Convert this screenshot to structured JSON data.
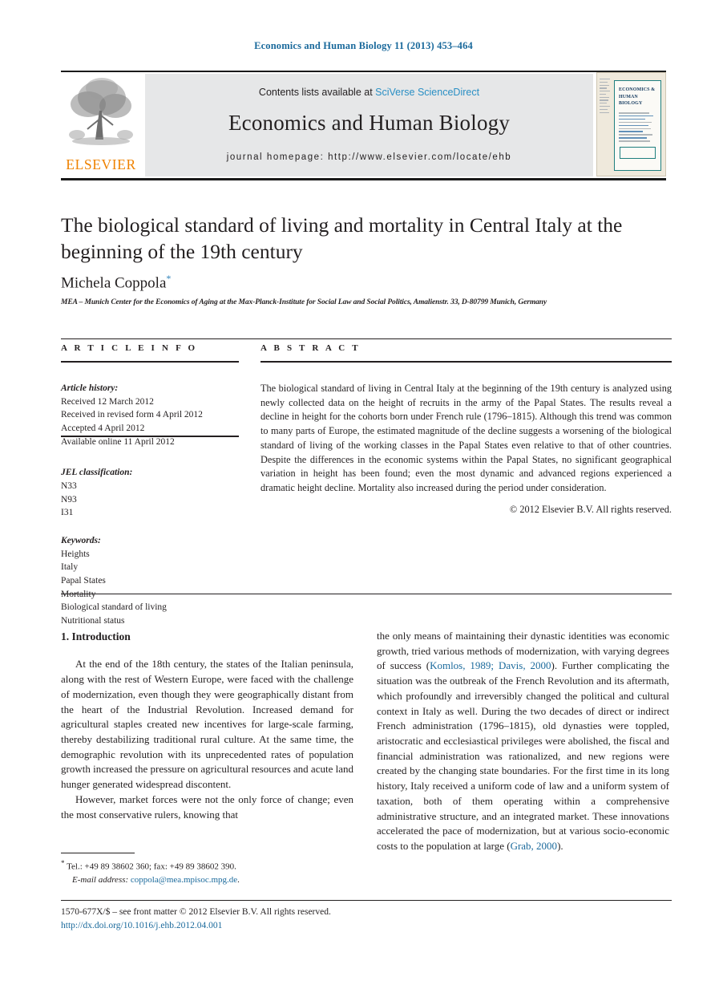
{
  "running_head": "Economics and Human Biology 11 (2013) 453–464",
  "masthead": {
    "contents_prefix": "Contents lists available at ",
    "sciencedirect": "SciVerse ScienceDirect",
    "journal_name": "Economics and Human Biology",
    "homepage": "journal homepage: http://www.elsevier.com/locate/ehb",
    "publisher_logo_text": "ELSEVIER",
    "cover_title": "ECONOMICS & HUMAN BIOLOGY",
    "accent_link_color": "#2a8fc4",
    "elsevier_orange": "#ef8200"
  },
  "article": {
    "title": "The biological standard of living and mortality in Central Italy at the beginning of the 19th century",
    "author": "Michela Coppola",
    "author_marker": "*",
    "affiliation": "MEA – Munich Center for the Economics of Aging at the Max-Planck-Institute for Social Law and Social Politics, Amalienstr. 33, D-80799 Munich, Germany"
  },
  "info": {
    "section_label": "A R T I C L E   I N F O",
    "history_head": "Article history:",
    "history": [
      "Received 12 March 2012",
      "Received in revised form 4 April 2012",
      "Accepted 4 April 2012",
      "Available online 11 April 2012"
    ],
    "jel_head": "JEL classification:",
    "jel": [
      "N33",
      "N93",
      "I31"
    ],
    "keywords_head": "Keywords:",
    "keywords": [
      "Heights",
      "Italy",
      "Papal States",
      "Mortality",
      "Biological standard of living",
      "Nutritional status"
    ]
  },
  "abstract": {
    "section_label": "A B S T R A C T",
    "text": "The biological standard of living in Central Italy at the beginning of the 19th century is analyzed using newly collected data on the height of recruits in the army of the Papal States. The results reveal a decline in height for the cohorts born under French rule (1796–1815). Although this trend was common to many parts of Europe, the estimated magnitude of the decline suggests a worsening of the biological standard of living of the working classes in the Papal States even relative to that of other countries. Despite the differences in the economic systems within the Papal States, no significant geographical variation in height has been found; even the most dynamic and advanced regions experienced a dramatic height decline. Mortality also increased during the period under consideration.",
    "copyright": "© 2012 Elsevier B.V. All rights reserved."
  },
  "body": {
    "section_heading": "1.  Introduction",
    "left_paragraphs": [
      "At the end of the 18th century, the states of the Italian peninsula, along with the rest of Western Europe, were faced with the challenge of modernization, even though they were geographically distant from the heart of the Industrial Revolution. Increased demand for agricultural staples created new incentives for large-scale farming, thereby destabilizing traditional rural culture. At the same time, the demographic revolution with its unprecedented rates of population growth increased the pressure on agricultural resources and acute land hunger generated widespread discontent.",
      "However, market forces were not the only force of change; even the most conservative rulers, knowing that"
    ],
    "right_paragraph_parts": {
      "p1_a": "the only means of maintaining their dynastic identities was economic growth, tried various methods of modernization, with varying degrees of success (",
      "cite1": "Komlos, 1989; Davis, 2000",
      "p1_b": "). Further complicating the situation was the outbreak of the French Revolution and its aftermath, which profoundly and irreversibly changed the political and cultural context in Italy as well. During the two decades of direct or indirect French administration (1796–1815), old dynasties were toppled, aristocratic and ecclesiastical privileges were abolished, the fiscal and financial administration was rationalized, and new regions were created by the changing state boundaries. For the first time in its long history, Italy received a uniform code of law and a uniform system of taxation, both of them operating within a comprehensive administrative structure, and an integrated market. These innovations accelerated the pace of modernization, but at various socio-economic costs to the population at large (",
      "cite2": "Grab, 2000",
      "p1_c": ")."
    }
  },
  "footnote": {
    "marker": "*",
    "tel": "Tel.: +49 89 38602 360; fax: +49 89 38602 390.",
    "email_label": "E-mail address:",
    "email": "coppola@mea.mpisoc.mpg.de",
    "email_trail": "."
  },
  "footer": {
    "issn_line": "1570-677X/$ – see front matter © 2012 Elsevier B.V. All rights reserved.",
    "doi": "http://dx.doi.org/10.1016/j.ehb.2012.04.001"
  }
}
